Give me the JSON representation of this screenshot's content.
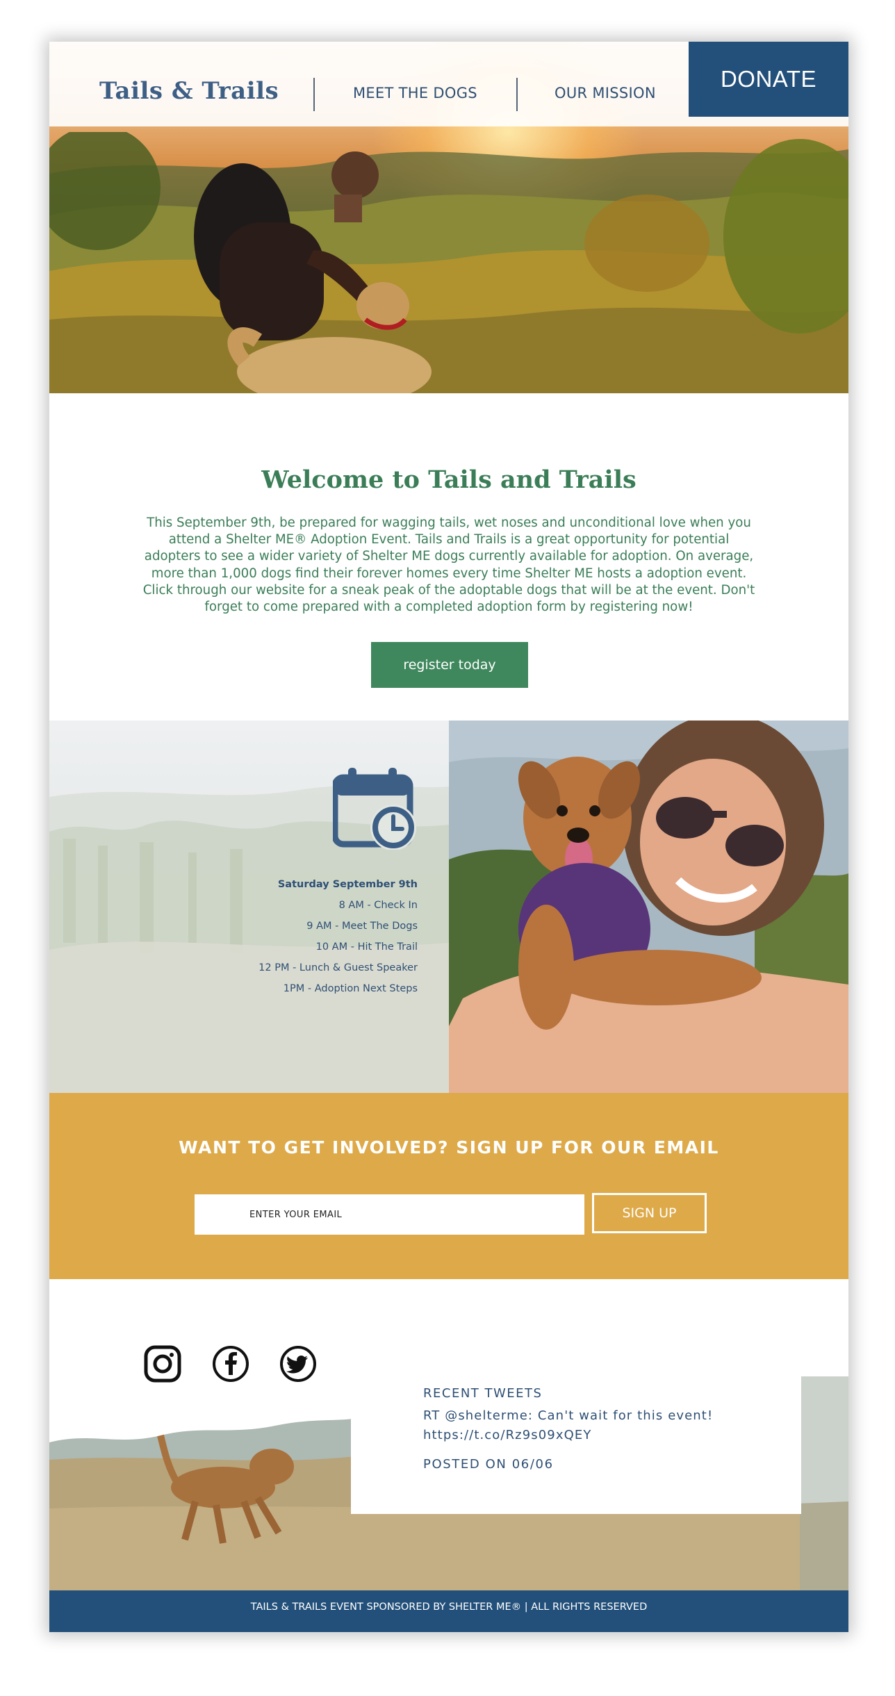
{
  "header": {
    "logo": "Tails & Trails",
    "nav": [
      "MEET THE DOGS",
      "OUR MISSION"
    ],
    "donate_label": "DONATE"
  },
  "welcome": {
    "title": "Welcome to Tails and Trails",
    "text": "This September 9th, be prepared for wagging tails, wet noses and unconditional love when you attend a Shelter ME® Adoption Event. Tails and Trails is a great opportunity for potential adopters to see a wider variety of Shelter ME dogs currently available for adoption. On average, more than 1,000 dogs find their forever homes every time Shelter ME hosts a adoption event. Click through our website for a sneak peak of the adoptable dogs that will be at the event. Don't forget to come prepared with a completed adoption form by registering now!",
    "button_label": "register today"
  },
  "schedule": {
    "icon": "calendar-clock-icon",
    "date": "Saturday September 9th",
    "items": [
      "8 AM - Check In",
      "9 AM - Meet The Dogs",
      "10 AM - Hit The Trail",
      "12 PM - Lunch & Guest Speaker",
      "1PM - Adoption Next Steps"
    ]
  },
  "newsletter": {
    "title": "WANT TO GET INVOLVED? SIGN UP FOR OUR EMAIL",
    "placeholder": "ENTER YOUR EMAIL",
    "button_label": "SIGN UP"
  },
  "social": {
    "icons": [
      "instagram-icon",
      "facebook-icon",
      "twitter-icon"
    ]
  },
  "tweets": {
    "heading": "RECENT TWEETS",
    "body": "RT @shelterme: Can't wait for this event! https://t.co/Rz9s09xQEY",
    "posted": "POSTED ON 06/06"
  },
  "footer": {
    "text": "TAILS & TRAILS EVENT SPONSORED BY SHELTER ME® | ALL RIGHTS RESERVED"
  },
  "colors": {
    "brand_navy": "#23507a",
    "brand_green": "#3f875d",
    "accent_gold": "#dea948"
  }
}
